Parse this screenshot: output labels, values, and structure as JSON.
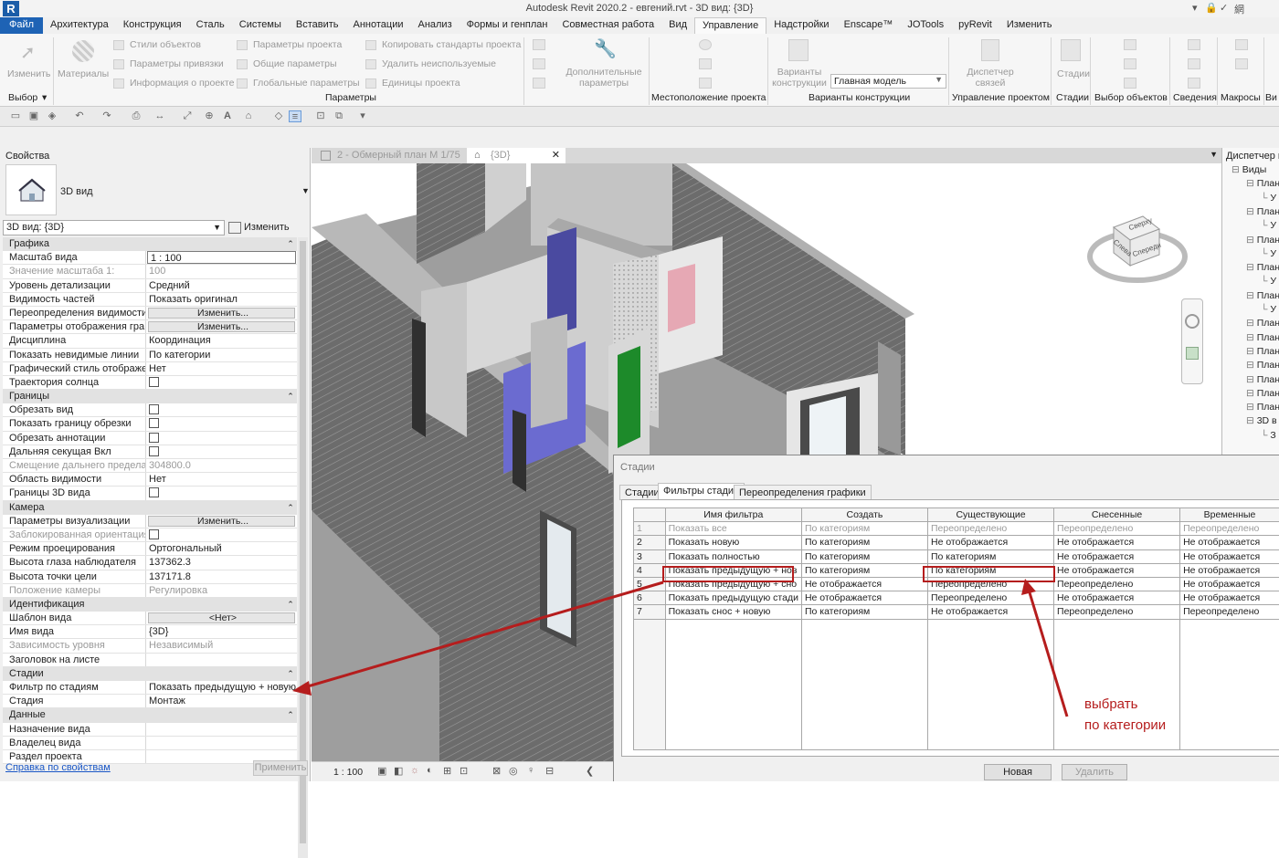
{
  "titlebar": {
    "title": "Autodesk Revit 2020.2 - евгений.rvt - 3D вид: {3D}",
    "user": "網",
    "logo": "R"
  },
  "ribbon_tabs": [
    "Файл",
    "Архитектура",
    "Конструкция",
    "Сталь",
    "Системы",
    "Вставить",
    "Аннотации",
    "Анализ",
    "Формы и генплан",
    "Совместная работа",
    "Вид",
    "Управление",
    "Надстройки",
    "Enscape™",
    "JOTools",
    "pyRevit",
    "Изменить"
  ],
  "active_tab": "Управление",
  "ribbon": {
    "modify": "Изменить",
    "materials": "Материалы",
    "select_panel": "Выбор",
    "settings_items": [
      "Стили объектов",
      "Параметры привязки",
      "Информация о проекте",
      "Параметры проекта",
      "Общие параметры",
      "Глобальные параметры",
      "Копировать стандарты проекта",
      "Удалить неиспользуемые",
      "Единицы проекта"
    ],
    "settings_panel": "Параметры",
    "additional_params": "Дополнительные параметры",
    "location_panel": "Местоположение проекта",
    "design_options_btn": "Варианты конструкции",
    "main_model": "Главная модель",
    "design_options_panel": "Варианты конструкции",
    "manage_links": "Диспетчер связей",
    "manage_project_panel": "Управление проектом",
    "phases_btn": "Стадии",
    "phases_panel": "Стадии",
    "selection_panel": "Выбор объектов",
    "inquiry_panel": "Сведения",
    "macros_panel": "Макросы",
    "vi": "Ви"
  },
  "properties": {
    "header": "Свойства",
    "type_name": "3D вид",
    "view_selector": "3D вид: {3D}",
    "edit_type": "Изменить тип",
    "rows": [
      {
        "kind": "cat",
        "name": "Графика"
      },
      {
        "name": "Масштаб вида",
        "value": "1 : 100",
        "style": "inp"
      },
      {
        "name": "Значение масштаба    1:",
        "value": "100",
        "dis": true
      },
      {
        "name": "Уровень детализации",
        "value": "Средний"
      },
      {
        "name": "Видимость частей",
        "value": "Показать оригинал"
      },
      {
        "name": "Переопределения видимости...",
        "value": "Изменить...",
        "style": "btn"
      },
      {
        "name": "Параметры отображения гра...",
        "value": "Изменить...",
        "style": "btn"
      },
      {
        "name": "Дисциплина",
        "value": "Координация"
      },
      {
        "name": "Показать невидимые линии",
        "value": "По категории"
      },
      {
        "name": "Графический стиль отображе...",
        "value": "Нет"
      },
      {
        "name": "Траектория солнца",
        "value": "",
        "style": "cb"
      },
      {
        "kind": "cat",
        "name": "Границы"
      },
      {
        "name": "Обрезать вид",
        "value": "",
        "style": "cb"
      },
      {
        "name": "Показать границу обрезки",
        "value": "",
        "style": "cb"
      },
      {
        "name": "Обрезать аннотации",
        "value": "",
        "style": "cb"
      },
      {
        "name": "Дальняя секущая Вкл",
        "value": "",
        "style": "cb"
      },
      {
        "name": "Смещение дальнего предела ...",
        "value": "304800.0",
        "dis": true
      },
      {
        "name": "Область видимости",
        "value": "Нет"
      },
      {
        "name": "Границы 3D вида",
        "value": "",
        "style": "cb"
      },
      {
        "kind": "cat",
        "name": "Камера"
      },
      {
        "name": "Параметры визуализации",
        "value": "Изменить...",
        "style": "btn"
      },
      {
        "name": "Заблокированная ориентация",
        "value": "",
        "style": "cb",
        "dis": true
      },
      {
        "name": "Режим проецирования",
        "value": "Ортогональный"
      },
      {
        "name": "Высота глаза наблюдателя",
        "value": "137362.3"
      },
      {
        "name": "Высота точки цели",
        "value": "137171.8"
      },
      {
        "name": "Положение камеры",
        "value": "Регулировка",
        "dis": true
      },
      {
        "kind": "cat",
        "name": "Идентификация"
      },
      {
        "name": "Шаблон вида",
        "value": "<Нет>",
        "style": "btn"
      },
      {
        "name": "Имя вида",
        "value": "{3D}"
      },
      {
        "name": "Зависимость уровня",
        "value": "Независимый",
        "dis": true
      },
      {
        "name": "Заголовок на листе",
        "value": ""
      },
      {
        "kind": "cat",
        "name": "Стадии"
      },
      {
        "name": "Фильтр по стадиям",
        "value": "Показать предыдущую + новую"
      },
      {
        "name": "Стадия",
        "value": "Монтаж"
      },
      {
        "kind": "cat",
        "name": "Данные"
      },
      {
        "name": "Назначение вида",
        "value": ""
      },
      {
        "name": "Владелец вида",
        "value": ""
      },
      {
        "name": "Раздел проекта",
        "value": ""
      }
    ],
    "help_link": "Справка по свойствам",
    "apply": "Применить"
  },
  "view_tabs": [
    {
      "label": "2 - Обмерный план М 1/75"
    },
    {
      "label": "{3D}",
      "close": "✕"
    }
  ],
  "view_bar": {
    "scale": "1 : 100"
  },
  "viewcube": {
    "top": "Сверху",
    "front": "Спереди",
    "left": "Слева"
  },
  "project_browser": {
    "header": "Диспетчер п",
    "items": [
      {
        "label": "Виды",
        "lvl": 0
      },
      {
        "label": "План",
        "lvl": 1
      },
      {
        "label": "У",
        "lvl": 2
      },
      {
        "label": "План",
        "lvl": 1
      },
      {
        "label": "У",
        "lvl": 2
      },
      {
        "label": "План",
        "lvl": 1
      },
      {
        "label": "У",
        "lvl": 2
      },
      {
        "label": "План",
        "lvl": 1
      },
      {
        "label": "У",
        "lvl": 2
      },
      {
        "label": "План",
        "lvl": 1
      },
      {
        "label": "У",
        "lvl": 2
      },
      {
        "label": "План",
        "lvl": 1
      },
      {
        "label": "План",
        "lvl": 1
      },
      {
        "label": "План",
        "lvl": 1
      },
      {
        "label": "План",
        "lvl": 1
      },
      {
        "label": "План",
        "lvl": 1
      },
      {
        "label": "План",
        "lvl": 1
      },
      {
        "label": "План",
        "lvl": 1
      },
      {
        "label": "3D в",
        "lvl": 1
      },
      {
        "label": "З",
        "lvl": 2
      }
    ]
  },
  "dialog": {
    "title": "Стадии",
    "tabs": [
      "Стадии",
      "Фильтры стадий",
      "Переопределения графики"
    ],
    "active_tab": "Фильтры стадий",
    "columns": [
      "Имя фильтра",
      "Создать",
      "Существующие",
      "Снесенные",
      "Временные"
    ],
    "rows": [
      {
        "num": "1",
        "name": "Показать все",
        "create": "По категориям",
        "existing": "Переопределено",
        "demolished": "Переопределено",
        "temporary": "Переопределено",
        "dis": true
      },
      {
        "num": "2",
        "name": "Показать новую",
        "create": "По категориям",
        "existing": "Не отображается",
        "demolished": "Не отображается",
        "temporary": "Не отображается"
      },
      {
        "num": "3",
        "name": "Показать полностью",
        "create": "По категориям",
        "existing": "По категориям",
        "demolished": "Не отображается",
        "temporary": "Не отображается"
      },
      {
        "num": "4",
        "name": "Показать предыдущую + нов",
        "create": "По категориям",
        "existing": "По категориям",
        "demolished": "Не отображается",
        "temporary": "Не отображается"
      },
      {
        "num": "5",
        "name": "Показать предыдущую + сно",
        "create": "Не отображается",
        "existing": "Переопределено",
        "demolished": "Переопределено",
        "temporary": "Не отображается"
      },
      {
        "num": "6",
        "name": "Показать предыдущую стади",
        "create": "Не отображается",
        "existing": "Переопределено",
        "demolished": "Не отображается",
        "temporary": "Не отображается"
      },
      {
        "num": "7",
        "name": "Показать снос + новую",
        "create": "По категориям",
        "existing": "Не отображается",
        "demolished": "Переопределено",
        "temporary": "Переопределено"
      }
    ],
    "new_btn": "Новая",
    "delete_btn": "Удалить"
  },
  "annotation": {
    "line1": "выбрать",
    "line2": "по категории",
    "color": "#b51d1d"
  }
}
